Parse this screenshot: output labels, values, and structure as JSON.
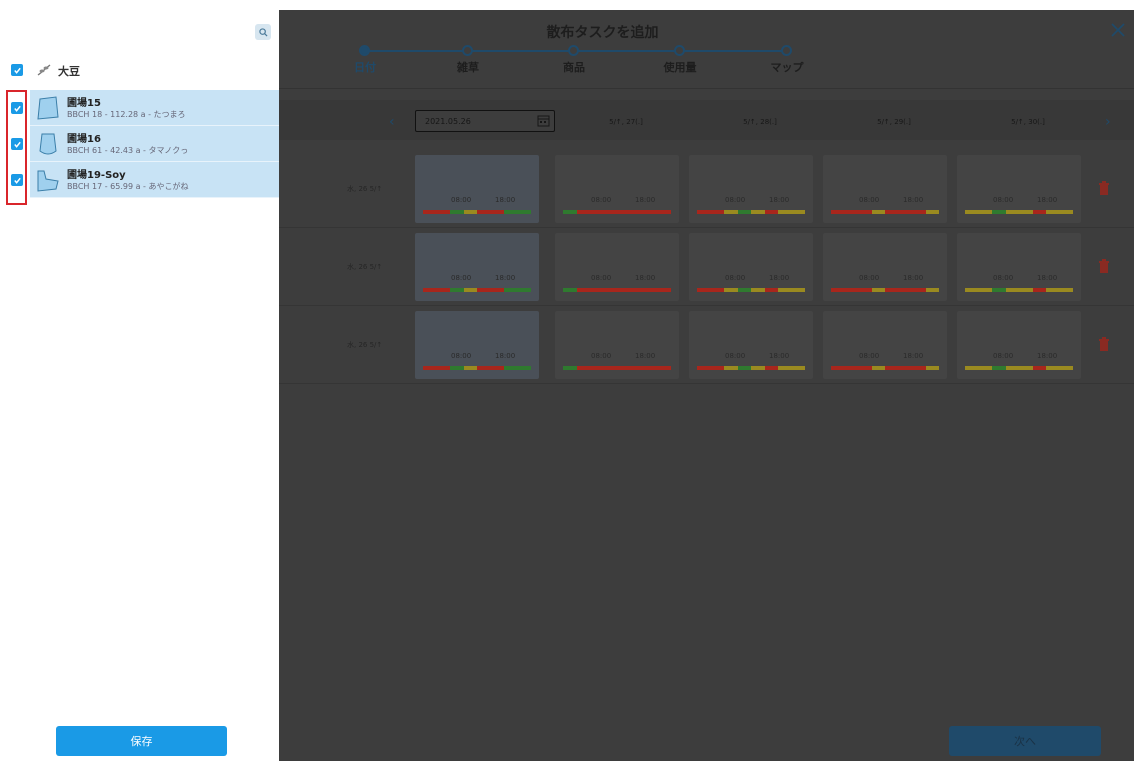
{
  "sidebar": {
    "crop": {
      "label": "大豆",
      "checked": true
    },
    "fields": [
      {
        "name": "圃場15",
        "meta": "BBCH 18 - 112.28 a - たつまろ",
        "checked": true
      },
      {
        "name": "圃場16",
        "meta": "BBCH 61 - 42.43 a - タマノクっ",
        "checked": true
      },
      {
        "name": "圃場19-Soy",
        "meta": "BBCH 17 - 65.99 a - あやこがね",
        "checked": true
      }
    ],
    "save_label": "保存"
  },
  "modal": {
    "title": "散布タスクを追加",
    "steps": [
      {
        "label": "日付",
        "active": true
      },
      {
        "label": "雑草",
        "active": false
      },
      {
        "label": "商品",
        "active": false
      },
      {
        "label": "使用量",
        "active": false
      },
      {
        "label": "マップ",
        "active": false
      }
    ],
    "date_input": "2021.05.26",
    "date_columns": [
      "5/↑, 27(.]",
      "5/↑, 28(.]",
      "5/↑, 29(.]",
      "5/↑, 30(.]"
    ],
    "rows": [
      {
        "label": "水, 26 5/↑"
      },
      {
        "label": "水, 26 5/↑"
      },
      {
        "label": "水, 26 5/↑"
      }
    ],
    "time_start": "08:00",
    "time_end": "18:00",
    "next_label": "次へ"
  },
  "colors": {
    "accent": "#1a9ae6",
    "selected_bg": "#c8e3f5",
    "highlight": "#d9252b",
    "bar_red": "#a8261c",
    "bar_green": "#2f7a2f",
    "bar_yellow": "#9a8a20"
  },
  "icons": [
    "search-icon",
    "check-icon",
    "crop-icon",
    "field-shape-icon",
    "close-icon",
    "calendar-icon",
    "chevron-left-icon",
    "chevron-right-icon",
    "trash-icon"
  ]
}
